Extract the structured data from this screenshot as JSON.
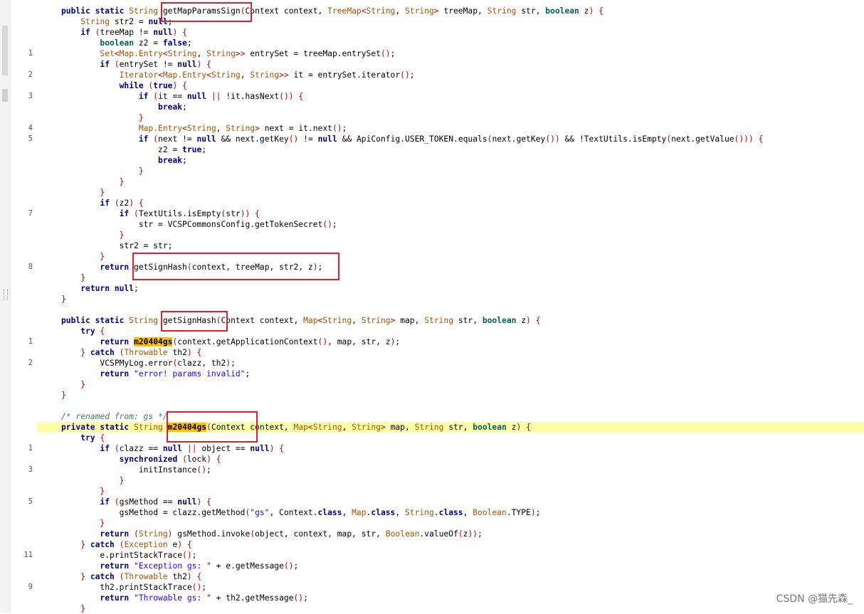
{
  "gutter_numbers": [
    "1",
    "2",
    "3",
    "4",
    "5",
    "7",
    "8",
    "1",
    "2",
    "1",
    "3",
    "5",
    "11",
    "9"
  ],
  "watermark": "CSDN @猫先森_",
  "method1": {
    "name": "getMapParamsSign",
    "call": "getSignHash"
  },
  "method2": {
    "name": "getSignHash",
    "call": "m20404gs"
  },
  "method3": {
    "comment": "/* renamed from: gs */",
    "name": "m20404gs"
  },
  "strings": {
    "error": "\"error! params invalid\"",
    "gs": "\"gs\"",
    "exception": "\"Exception gs: \"",
    "throwable": "\"Throwable gs: \""
  }
}
